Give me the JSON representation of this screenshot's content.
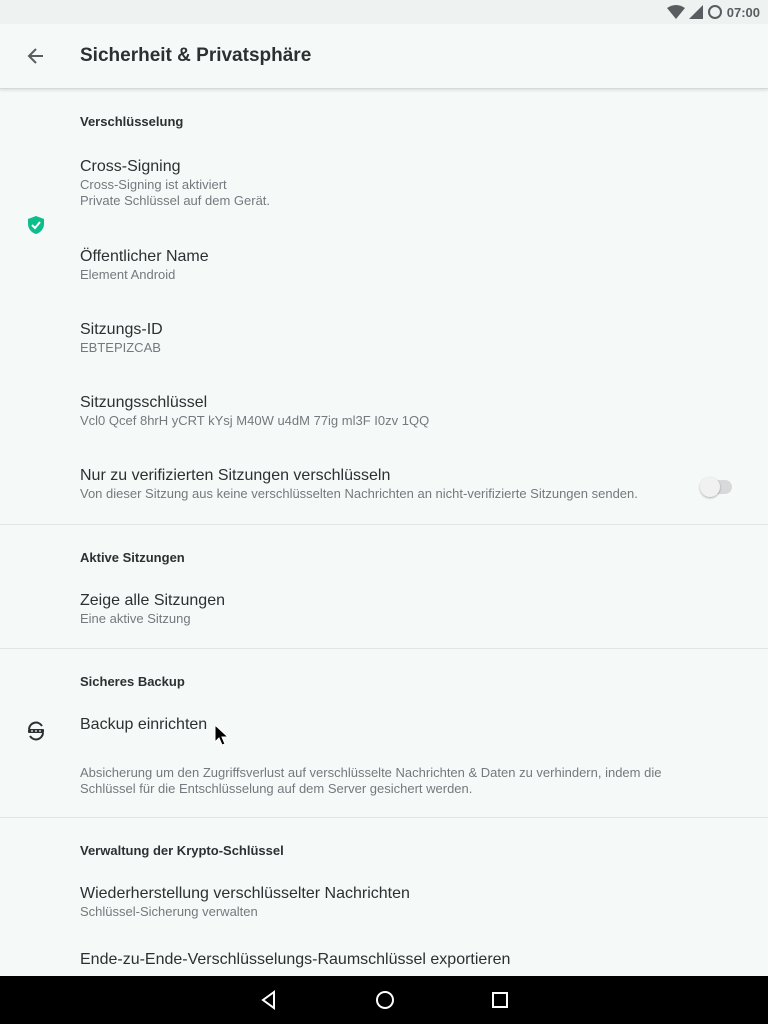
{
  "status_bar": {
    "time": "07:00"
  },
  "app_bar": {
    "title": "Sicherheit & Privatsphäre"
  },
  "sections": {
    "encryption": {
      "header": "Verschlüsselung",
      "cross_signing": {
        "title": "Cross-Signing",
        "summary_line1": "Cross-Signing ist aktiviert",
        "summary_line2": "Private Schlüssel auf dem Gerät."
      },
      "public_name": {
        "title": "Öffentlicher Name",
        "summary": "Element Android"
      },
      "session_id": {
        "title": "Sitzungs-ID",
        "summary": "EBTEPIZCAB"
      },
      "session_key": {
        "title": "Sitzungsschlüssel",
        "summary": "Vcl0 Qcef 8hrH yCRT kYsj M40W u4dM 77ig ml3F I0zv 1QQ"
      },
      "verified_only": {
        "title": "Nur zu verifizierten Sitzungen verschlüsseln",
        "summary": "Von dieser Sitzung aus keine verschlüsselten Nachrichten an nicht-verifizierte Sitzungen senden.",
        "enabled": false
      }
    },
    "active_sessions": {
      "header": "Aktive Sitzungen",
      "show_all": {
        "title": "Zeige alle Sitzungen",
        "summary": "Eine aktive Sitzung"
      }
    },
    "secure_backup": {
      "header": "Sicheres Backup",
      "setup": {
        "title": "Backup einrichten"
      },
      "info": "Absicherung um den Zugriffsverlust auf verschlüsselte Nachrichten & Daten zu verhindern, indem die Schlüssel für die Entschlüsselung auf dem Server gesichert werden."
    },
    "crypto_keys": {
      "header": "Verwaltung der Krypto-Schlüssel",
      "restore": {
        "title": "Wiederherstellung verschlüsselter Nachrichten",
        "summary": "Schlüssel-Sicherung verwalten"
      },
      "export": {
        "title": "Ende-zu-Ende-Verschlüsselungs-Raumschlüssel exportieren"
      }
    }
  },
  "colors": {
    "accent": "#0dbd8b",
    "background": "#f5faf8"
  }
}
